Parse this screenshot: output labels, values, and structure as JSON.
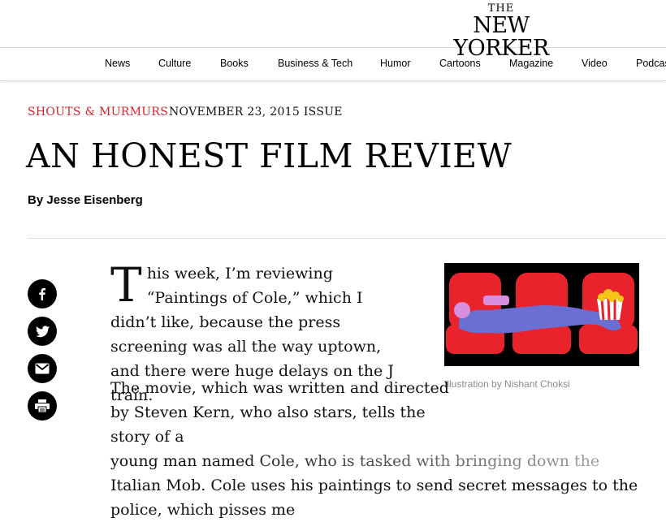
{
  "site": {
    "logo_top": "THE",
    "logo_name": "NEW YORKER"
  },
  "nav": {
    "items": [
      "News",
      "Culture",
      "Books",
      "Business & Tech",
      "Humor",
      "Cartoons",
      "Magazine",
      "Video",
      "Podcasts"
    ]
  },
  "article": {
    "rubric": "Shouts & Murmurs",
    "issue": "November 23, 2015 Issue",
    "headline": "AN HONEST FILM REVIEW",
    "byline_prefix": "By",
    "author": "Jesse Eisenberg",
    "dropcap": "T",
    "p1_rest": "his week, I’m reviewing “Paintings of Cole,” which I didn’t like, because the press screening was all the way uptown, and there were huge delays on the J train.",
    "p2_a": "The movie, which was written and directed by Steven Kern, who also stars, tells the story of a",
    "p2_b": "young man named Cole, who is tasked with bringing down the Italian Mob. Cole uses his paintings to send secret messages to the police, which pisses me"
  },
  "illustration": {
    "caption": "Illustration by Nishant Choksi",
    "seat_color": "#e8232b",
    "man_color": "#6b6fd1",
    "skin_color": "#d98fe0",
    "popcorn_color": "#f5c518"
  },
  "share": {
    "icons": [
      "facebook-icon",
      "twitter-icon",
      "email-icon",
      "print-icon"
    ]
  }
}
